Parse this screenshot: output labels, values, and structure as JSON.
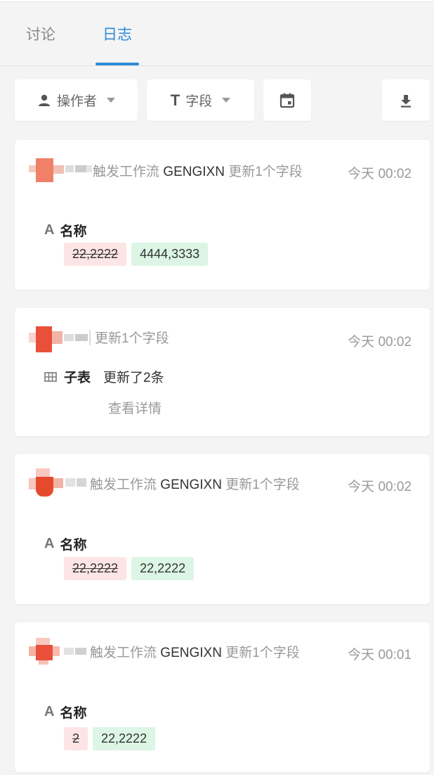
{
  "tabs": {
    "discuss": "讨论",
    "log": "日志"
  },
  "toolbar": {
    "operator": "操作者",
    "field": "字段"
  },
  "colors": {
    "accent": "#2d8ad8",
    "old_chip": "#fde5e5",
    "new_chip": "#dcf5e5"
  },
  "logs": [
    {
      "text_prefix": "触发工作流",
      "workflow": "GENGIXN",
      "text_suffix": "更新1个字段",
      "time": "今天 00:02",
      "field_name": "名称",
      "old_value": "22,2222",
      "new_value": "4444,3333"
    },
    {
      "text_prefix": "更新1个字段",
      "time": "今天 00:02",
      "field_name": "子表",
      "desc": "更新了2条",
      "detail_link": "查看详情"
    },
    {
      "text_prefix": "触发工作流",
      "workflow": "GENGIXN",
      "text_suffix": "更新1个字段",
      "time": "今天 00:02",
      "field_name": "名称",
      "old_value": "22,2222",
      "new_value": "22,2222"
    },
    {
      "text_prefix": "触发工作流",
      "workflow": "GENGIXN",
      "text_suffix": "更新1个字段",
      "time": "今天 00:01",
      "field_name": "名称",
      "old_value": "2",
      "new_value": "22,2222"
    }
  ]
}
